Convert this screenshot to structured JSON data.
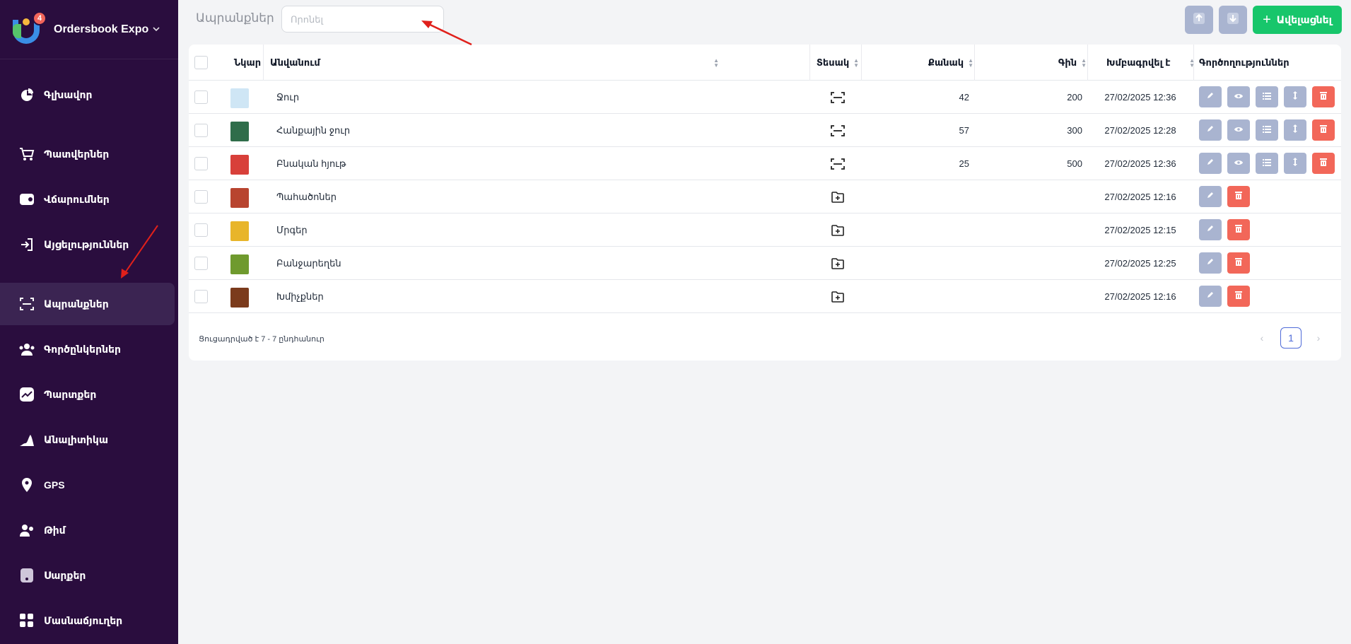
{
  "brand": {
    "name": "Ordersbook Expo",
    "badge": "4"
  },
  "sidebar": {
    "items": [
      {
        "label": "Գլխավոր",
        "icon": "pie-chart-icon"
      },
      {
        "label": "Պատվերներ",
        "icon": "cart-icon"
      },
      {
        "label": "Վճարումներ",
        "icon": "wallet-icon"
      },
      {
        "label": "Այցելություններ",
        "icon": "login-icon"
      },
      {
        "label": "Ապրանքներ",
        "icon": "scan-icon",
        "active": true
      },
      {
        "label": "Գործընկերներ",
        "icon": "users-icon"
      },
      {
        "label": "Պարտքեր",
        "icon": "trend-chart-icon"
      },
      {
        "label": "Անալիտիկա",
        "icon": "analytics-icon"
      },
      {
        "label": "GPS",
        "icon": "map-pin-icon"
      },
      {
        "label": "Թիմ",
        "icon": "team-icon"
      },
      {
        "label": "Սարքեր",
        "icon": "device-icon"
      },
      {
        "label": "Մասնաճյուղեր",
        "icon": "grid-icon"
      }
    ]
  },
  "header": {
    "title": "Ապրանքներ",
    "search_placeholder": "Որոնել",
    "add_label": "Ավելացնել"
  },
  "table": {
    "columns": [
      "Նկար",
      "Անվանում",
      "Տեսակ",
      "Քանակ",
      "Գին",
      "Խմբագրվել է",
      "Գործողություններ"
    ],
    "rows": [
      {
        "name": "Ջուր",
        "type": "product",
        "qty": "42",
        "price": "200",
        "edited": "27/02/2025 12:36",
        "thumb": "#cfe6f5"
      },
      {
        "name": "Հանքային ջուր",
        "type": "product",
        "qty": "57",
        "price": "300",
        "edited": "27/02/2025 12:28",
        "thumb": "#2f6d4a"
      },
      {
        "name": "Բնական հյութ",
        "type": "product",
        "qty": "25",
        "price": "500",
        "edited": "27/02/2025 12:36",
        "thumb": "#d8403a"
      },
      {
        "name": "Պահածոներ",
        "type": "category",
        "qty": "",
        "price": "",
        "edited": "27/02/2025 12:16",
        "thumb": "#b8442f"
      },
      {
        "name": "Մրգեր",
        "type": "category",
        "qty": "",
        "price": "",
        "edited": "27/02/2025 12:15",
        "thumb": "#e8b52a"
      },
      {
        "name": "Բանջարեղեն",
        "type": "category",
        "qty": "",
        "price": "",
        "edited": "27/02/2025 12:25",
        "thumb": "#6f9a2e"
      },
      {
        "name": "Խմիչքներ",
        "type": "category",
        "qty": "",
        "price": "",
        "edited": "27/02/2025 12:16",
        "thumb": "#7b3b1c"
      }
    ],
    "footer": "Ցուցադրված է 7 - 7 ընդհանուր",
    "current_page": "1"
  },
  "colors": {
    "sidebar": "#2a0d3e",
    "accent_green": "#17c66b",
    "action_gray": "#a9b4d0",
    "action_red": "#f26759",
    "annotation_arrow": "#e0201b"
  }
}
